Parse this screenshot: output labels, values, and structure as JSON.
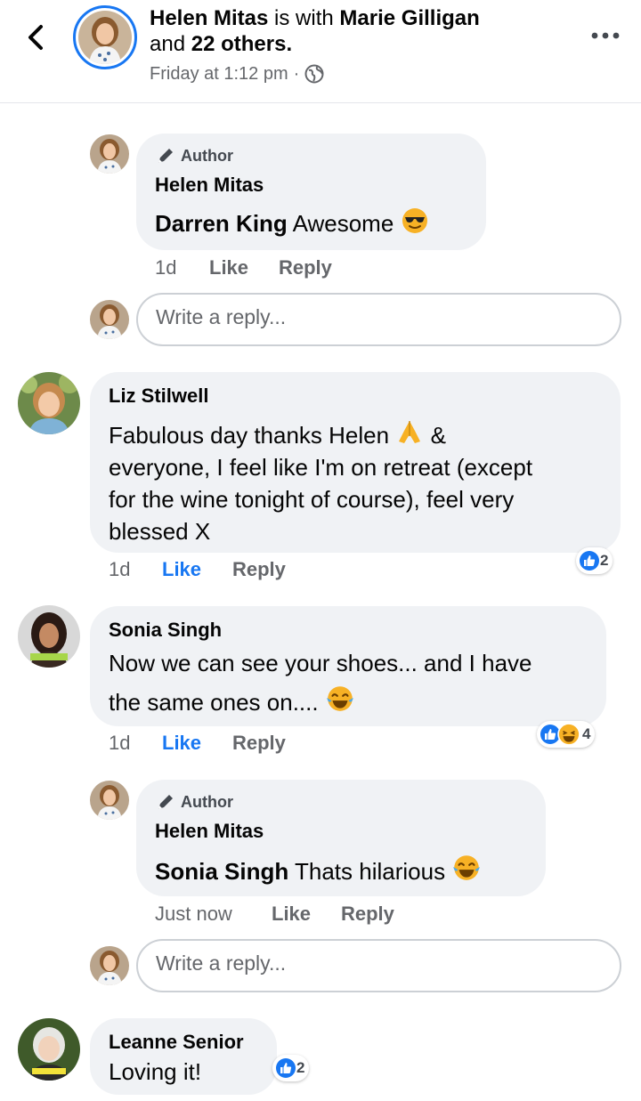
{
  "header": {
    "poster": "Helen Mitas",
    "is_with": "is with",
    "tagged": "Marie Gilligan",
    "and": "and",
    "others": "22 others",
    "period": ".",
    "time": "Friday at 1:12 pm",
    "separator": "·",
    "privacy_icon": "globe-icon"
  },
  "comments": [
    {
      "is_reply": true,
      "author_label": "Author",
      "name": "Helen Mitas",
      "mention": "Darren King",
      "text": "Awesome",
      "emoji": "smiling-face-with-sunglasses",
      "time": "1d",
      "like": "Like",
      "reply": "Reply",
      "liked": false
    },
    {
      "is_reply": false,
      "name": "Liz Stilwell",
      "lines": [
        "Fabulous day thanks Helen",
        "everyone, I feel like I'm on retreat (except",
        "for the wine tonight of course), feel very",
        "blessed X"
      ],
      "line1_suffix": "&",
      "emoji": "folded-hands",
      "time": "1d",
      "like": "Like",
      "reply": "Reply",
      "liked": true,
      "reaction_count": "2"
    },
    {
      "is_reply": false,
      "name": "Sonia Singh",
      "lines": [
        "Now we can see your shoes... and I have",
        "the same ones on...."
      ],
      "emoji": "face-with-tears-of-joy",
      "time": "1d",
      "like": "Like",
      "reply": "Reply",
      "liked": true,
      "reaction_count": "4"
    },
    {
      "is_reply": true,
      "author_label": "Author",
      "name": "Helen Mitas",
      "mention": "Sonia Singh",
      "text": "Thats hilarious",
      "emoji": "face-with-tears-of-joy",
      "time": "Just now",
      "like": "Like",
      "reply": "Reply",
      "liked": false
    },
    {
      "is_reply": false,
      "name": "Leanne Senior",
      "text": "Loving it!",
      "reaction_count": "2"
    }
  ],
  "reply_box": {
    "placeholder": "Write a reply..."
  },
  "colors": {
    "accent": "#1877f2",
    "bubble": "#f0f2f5",
    "muted": "#65676b",
    "haha": "#f7b125"
  }
}
